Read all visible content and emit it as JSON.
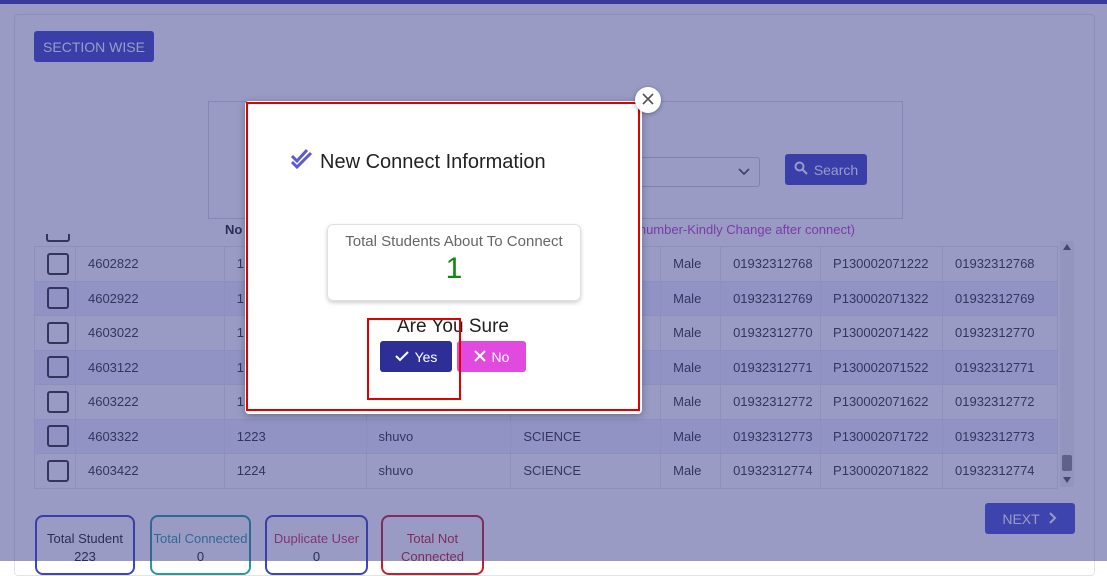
{
  "header": {
    "section_wise_label": "SECTION WISE"
  },
  "filter": {
    "search_label": "Search"
  },
  "table": {
    "header_fragment": "No",
    "note_fragment": "e number-Kindly Change after connect)",
    "rows": [
      {
        "id": "4602822",
        "roll": "1",
        "name": "",
        "group": "",
        "gender": "Male",
        "mobile": "01932312768",
        "code": "P130002071222",
        "contact": "01932312768"
      },
      {
        "id": "4602922",
        "roll": "1",
        "name": "",
        "group": "",
        "gender": "Male",
        "mobile": "01932312769",
        "code": "P130002071322",
        "contact": "01932312769"
      },
      {
        "id": "4603022",
        "roll": "1",
        "name": "",
        "group": "",
        "gender": "Male",
        "mobile": "01932312770",
        "code": "P130002071422",
        "contact": "01932312770"
      },
      {
        "id": "4603122",
        "roll": "1",
        "name": "",
        "group": "",
        "gender": "Male",
        "mobile": "01932312771",
        "code": "P130002071522",
        "contact": "01932312771"
      },
      {
        "id": "4603222",
        "roll": "1",
        "name": "",
        "group": "",
        "gender": "Male",
        "mobile": "01932312772",
        "code": "P130002071622",
        "contact": "01932312772"
      },
      {
        "id": "4603322",
        "roll": "1223",
        "name": "shuvo",
        "group": "SCIENCE",
        "gender": "Male",
        "mobile": "01932312773",
        "code": "P130002071722",
        "contact": "01932312773"
      },
      {
        "id": "4603422",
        "roll": "1224",
        "name": "shuvo",
        "group": "SCIENCE",
        "gender": "Male",
        "mobile": "01932312774",
        "code": "P130002071822",
        "contact": "01932312774"
      }
    ]
  },
  "stats": {
    "total_student_label": "Total Student",
    "total_student_value": "223",
    "total_connected_label": "Total Connected",
    "total_connected_value": "0",
    "duplicate_user_label": "Duplicate User",
    "duplicate_user_value": "0",
    "total_not_connected_label": "Total Not Connected"
  },
  "pagination": {
    "next_label": "NEXT"
  },
  "modal": {
    "title": "New Connect Information",
    "card_label": "Total Students About To Connect",
    "card_value": "1",
    "confirm_question": "Are You Sure",
    "yes_label": "Yes",
    "no_label": "No"
  },
  "icons": {
    "title": "double-check-icon",
    "search": "search-icon",
    "yes": "check-icon",
    "no": "x-icon",
    "next": "chevron-right-icon",
    "close": "close-icon",
    "select": "chevron-down-icon"
  },
  "colors": {
    "primary": "#3e45c4",
    "yes_button": "#2e2f96",
    "no_button": "#e04adf",
    "success_count": "#0f8a0f",
    "highlight": "#e00000",
    "note_text": "#c040c0",
    "total_connected_border": "#2a9a9a",
    "duplicate_user_border": "#d0305a",
    "total_not_connected_border": "#c8202a"
  }
}
